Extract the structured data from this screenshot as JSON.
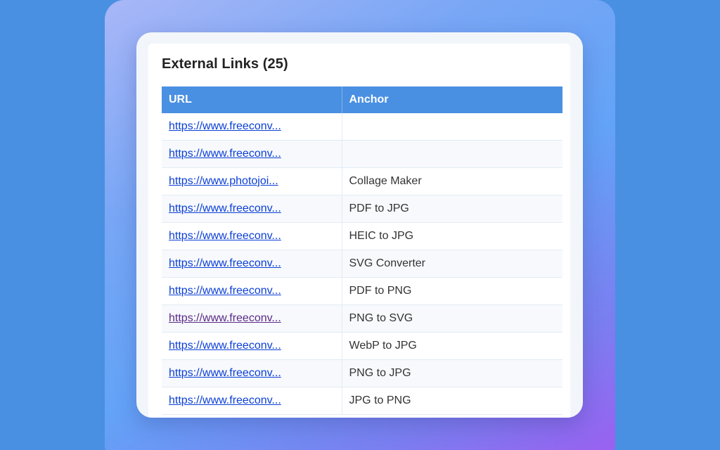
{
  "panel": {
    "title": "External Links (25)"
  },
  "table": {
    "headers": {
      "url": "URL",
      "anchor": "Anchor"
    },
    "rows": [
      {
        "url": "https://www.freeconv...",
        "anchor": ""
      },
      {
        "url": "https://www.freeconv...",
        "anchor": ""
      },
      {
        "url": "https://www.photojoi...",
        "anchor": "Collage Maker"
      },
      {
        "url": "https://www.freeconv...",
        "anchor": "PDF to JPG"
      },
      {
        "url": "https://www.freeconv...",
        "anchor": "HEIC to JPG"
      },
      {
        "url": "https://www.freeconv...",
        "anchor": "SVG Converter"
      },
      {
        "url": "https://www.freeconv...",
        "anchor": "PDF to PNG"
      },
      {
        "url": "https://www.freeconv...",
        "anchor": "PNG to SVG",
        "visited": true
      },
      {
        "url": "https://www.freeconv...",
        "anchor": "WebP to JPG"
      },
      {
        "url": "https://www.freeconv...",
        "anchor": "PNG to JPG"
      },
      {
        "url": "https://www.freeconv...",
        "anchor": "JPG to PNG"
      }
    ]
  },
  "colors": {
    "header_bg": "#4a90e2",
    "link": "#0b3fd6",
    "link_visited": "#5c2a86",
    "page_bg": "#4a90e2"
  }
}
